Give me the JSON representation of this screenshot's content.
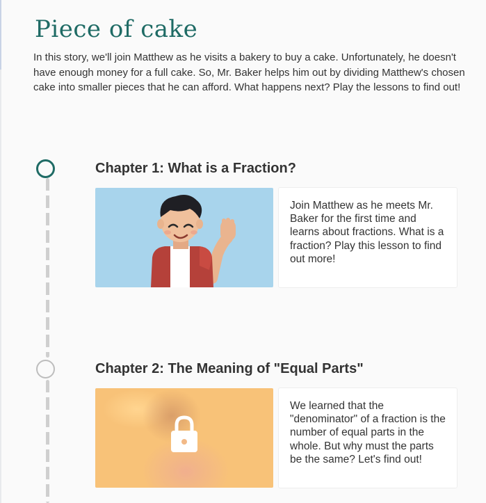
{
  "story": {
    "title": "Piece of cake",
    "description": "In this story, we'll join Matthew as he visits a bakery to buy a cake. Unfortunately, he doesn't have enough money for a full cake. So, Mr. Baker helps him out by dividing Matthew's chosen cake into smaller pieces that he can afford. What happens next? Play the lessons to find out!"
  },
  "chapters": [
    {
      "title": "Chapter 1: What is a Fraction?",
      "description": "Join Matthew as he meets Mr. Baker for the first time and learns about fractions. What is a fraction? Play this lesson to find out more!",
      "state": "available"
    },
    {
      "title": "Chapter 2: The Meaning of \"Equal Parts\"",
      "description": "We learned that the \"denominator\" of a fraction is the number of equal parts in the whole. But why must the parts be the same? Let's find out!",
      "state": "locked"
    }
  ],
  "colors": {
    "accent": "#1f6b65",
    "timeline": "#cfcfcf",
    "locked_node": "#bdbdbd"
  },
  "icons": [
    "lock-icon"
  ]
}
